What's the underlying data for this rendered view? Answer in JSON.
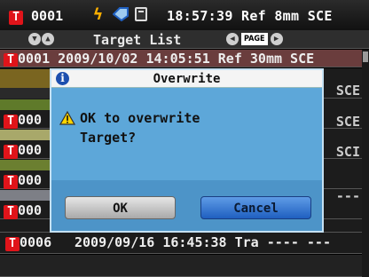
{
  "status": {
    "target_id": "0001",
    "time": "18:57:39",
    "mode": "Ref",
    "aperture": "8mm",
    "spec": "SCE"
  },
  "title": "Target List",
  "page_label": "PAGE",
  "list": {
    "row1": {
      "id": "0001",
      "text": "2009/10/02 14:05:51 Ref 30mm SCE"
    },
    "partial_ids": [
      "000",
      "000",
      "000",
      "000"
    ],
    "right_values": [
      "SCE",
      "SCE",
      "SCI",
      "---"
    ],
    "swatch_colors": [
      "#7a6520",
      "#5f7a2a",
      "#a8a86a",
      "#6b7f30"
    ],
    "row6": {
      "id": "0006",
      "text": "2009/09/16 16:45:38 Tra ---- ---"
    }
  },
  "dialog": {
    "title": "Overwrite",
    "message_line1": "OK to overwrite",
    "message_line2": "Target?",
    "ok_label": "OK",
    "cancel_label": "Cancel"
  },
  "colors": {
    "dialog_bg": "#5da7d9",
    "cancel_accent": "#1f5fc0",
    "target_red": "#e0141a"
  }
}
